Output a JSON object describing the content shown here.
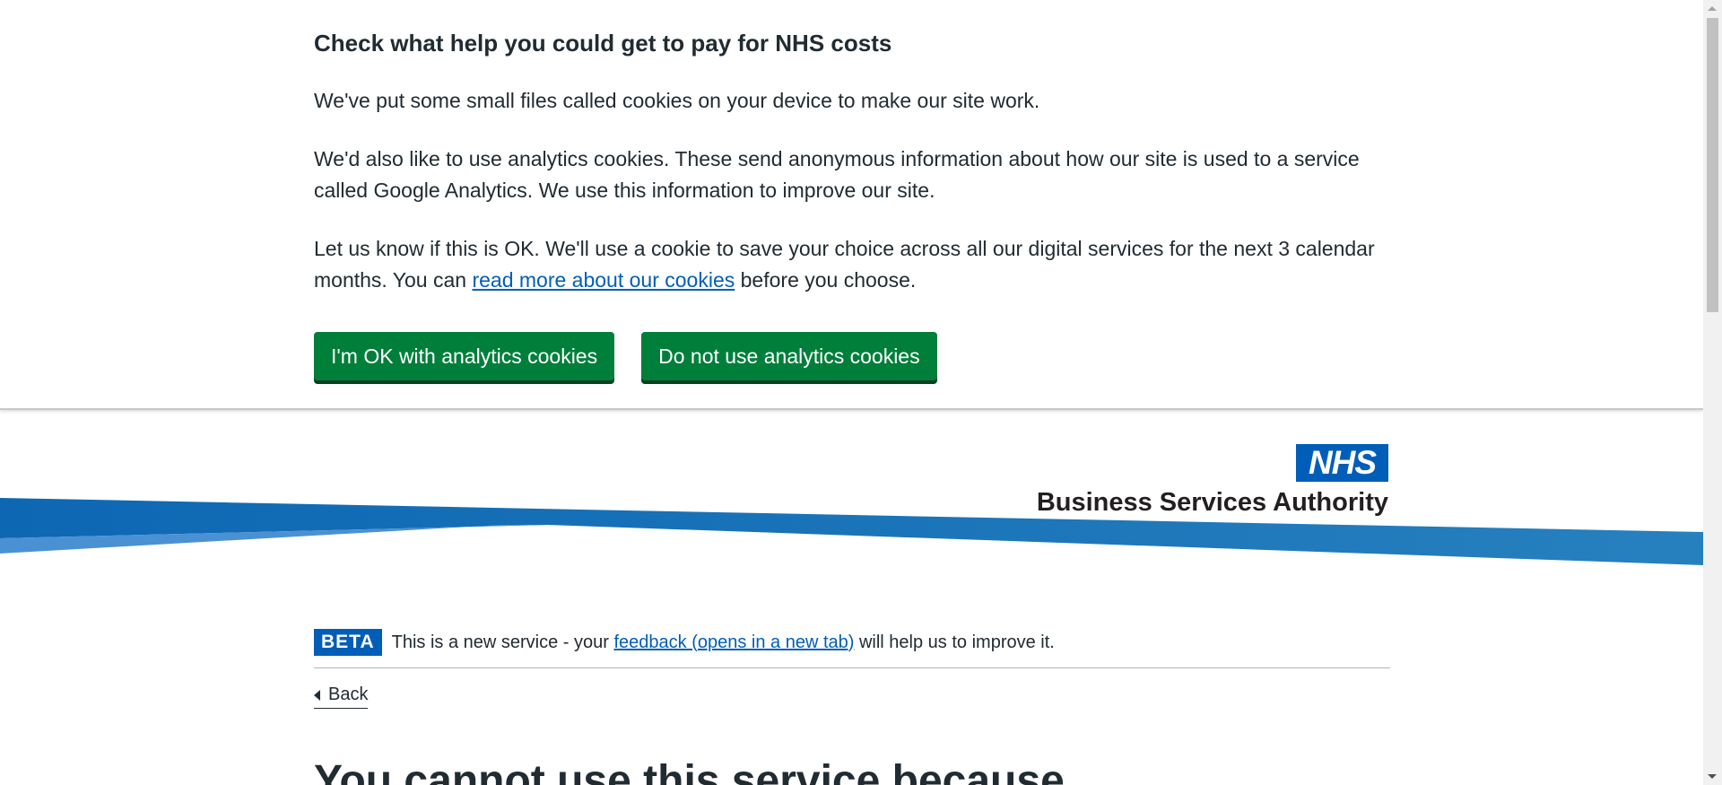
{
  "cookie_banner": {
    "heading": "Check what help you could get to pay for NHS costs",
    "p1": "We've put some small files called cookies on your device to make our site work.",
    "p2": "We'd also like to use analytics cookies. These send anonymous information about how our site is used to a service called Google Analytics. We use this information to improve our site.",
    "p3_before": "Let us know if this is OK. We'll use a cookie to save your choice across all our digital services for the next 3 calendar months. You can ",
    "p3_link": "read more about our cookies",
    "p3_after": " before you choose.",
    "accept_label": "I'm OK with analytics cookies",
    "reject_label": "Do not use analytics cookies"
  },
  "header": {
    "logo_text": "NHS",
    "org_name": "Business Services Authority"
  },
  "phase_banner": {
    "tag": "BETA",
    "text_before": "This is a new service - your ",
    "link": "feedback (opens in a new tab)",
    "text_after": " will help us to improve it."
  },
  "back_link": "Back",
  "page_heading": "You cannot use this service because",
  "colors": {
    "nhs_blue": "#005eb8",
    "button_green": "#007f3b",
    "text": "#212b32"
  }
}
